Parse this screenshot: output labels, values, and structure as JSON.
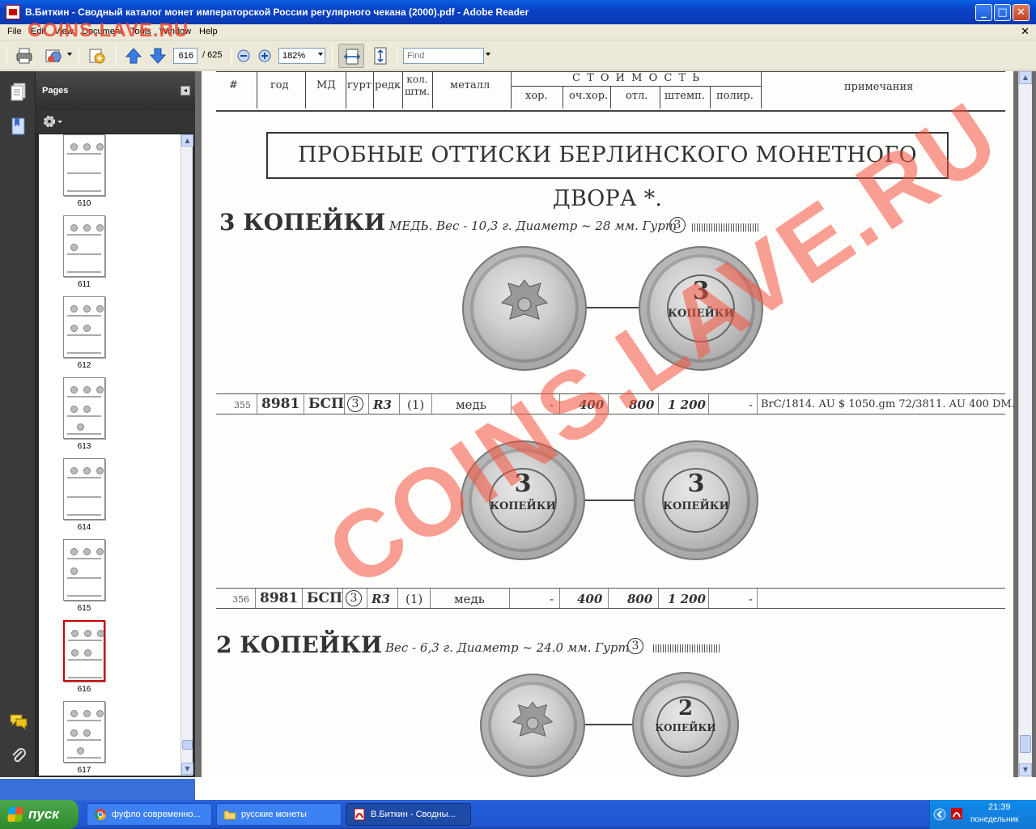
{
  "window": {
    "title": "В.Биткин - Сводный каталог монет императорской России регулярного чекана (2000).pdf - Adobe Reader",
    "minimize": "_",
    "maximize": "□",
    "close": "✕"
  },
  "menu": {
    "items": [
      "File",
      "Edit",
      "View",
      "Document",
      "Tools",
      "Window",
      "Help"
    ],
    "close_doc": "✕"
  },
  "watermark_small": "COINS.LAVE.RU",
  "watermark_large": "COINS.LAVE.RU",
  "toolbar": {
    "page_current": "616",
    "page_total": "/ 625",
    "zoom": "182%",
    "find_placeholder": "Find"
  },
  "sidebar": {
    "panel_title": "Pages",
    "thumbnails": [
      {
        "label": "610",
        "selected": false
      },
      {
        "label": "611",
        "selected": false
      },
      {
        "label": "612",
        "selected": false
      },
      {
        "label": "613",
        "selected": false
      },
      {
        "label": "614",
        "selected": false
      },
      {
        "label": "615",
        "selected": false
      },
      {
        "label": "616",
        "selected": true
      },
      {
        "label": "617",
        "selected": false
      }
    ]
  },
  "document": {
    "table_header": {
      "num": "#",
      "year": "год",
      "md": "МД",
      "edge": "гурт",
      "rarity": "редк",
      "count": "кол. штм.",
      "metal": "металл",
      "cost": "С Т О И М О С Т Ь",
      "grades": [
        "хор.",
        "оч.хор.",
        "отл.",
        "штемп.",
        "полир."
      ],
      "notes": "примечания"
    },
    "section_title": "ПРОБНЫЕ ОТТИСКИ БЕРЛИНСКОГО МОНЕТНОГО ДВОРА *.",
    "denom1": {
      "title": "3 КОПЕЙКИ",
      "subtitle": "МЕДЬ. Вес - 10,3  г.  Диаметр ~ 28 мм. Гурт",
      "edge_mark": "3"
    },
    "coin_texts": {
      "kopek3": "3",
      "kopek3_word": "КОПЕЙКИ",
      "kopek2": "2",
      "kopek2_word": "КОПЕЙКИ"
    },
    "rows": [
      {
        "num": "355",
        "year": "8981",
        "md": "БСП",
        "edge": "3",
        "rarity": "R3",
        "count": "(1)",
        "metal": "медь",
        "v1": "-",
        "v2": "400",
        "v3": "800",
        "v4": "1 200",
        "v5": "-",
        "note": "BrC/1814. AU $ 1050.gm 72/3811. AU 400 DM."
      },
      {
        "num": "356",
        "year": "8981",
        "md": "БСП",
        "edge": "3",
        "rarity": "R3",
        "count": "(1)",
        "metal": "медь",
        "v1": "-",
        "v2": "400",
        "v3": "800",
        "v4": "1 200",
        "v5": "-",
        "note": ""
      }
    ],
    "denom2": {
      "title": "2 КОПЕЙКИ",
      "subtitle": "Вес - 6,3 г.  Диаметр ~ 24.0 мм. Гурт",
      "edge_mark": "3"
    }
  },
  "taskbar": {
    "start": "пуск",
    "tasks": [
      {
        "label": "фуфло современно...",
        "active": false
      },
      {
        "label": "русские монеты",
        "active": false
      },
      {
        "label": "В.Биткин - Сводны...",
        "active": true
      }
    ],
    "time": "21:39",
    "day": "понедельник"
  }
}
